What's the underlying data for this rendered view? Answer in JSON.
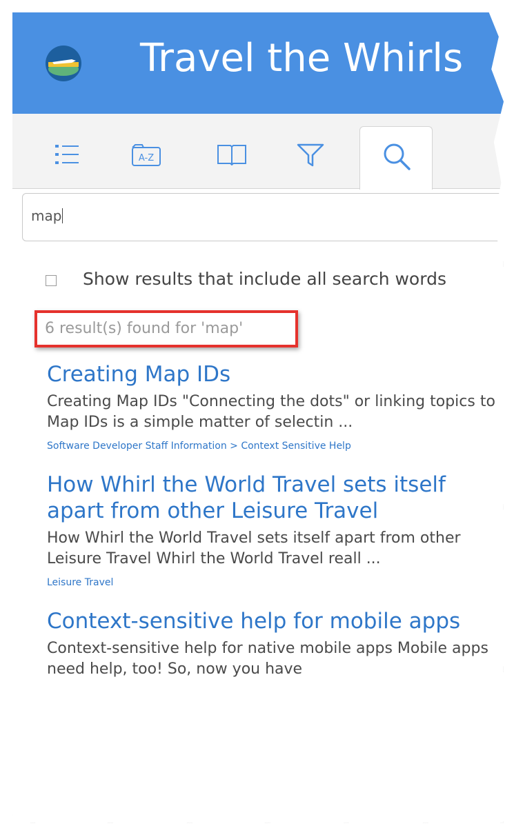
{
  "app": {
    "title": "Travel the Whirls",
    "logo_icon": "globe-airplane-logo"
  },
  "colors": {
    "header": "#4a90e2",
    "link": "#2e76c8",
    "highlight": "#e5322d"
  },
  "toolbar": {
    "tabs": [
      {
        "icon": "list-icon",
        "active": false
      },
      {
        "icon": "a-z-index-icon",
        "active": false
      },
      {
        "icon": "book-icon",
        "active": false
      },
      {
        "icon": "filter-icon",
        "active": false
      },
      {
        "icon": "search-icon",
        "active": true
      }
    ],
    "index_glyph": "A-Z"
  },
  "search": {
    "value": "map"
  },
  "options": {
    "all_words_label": "Show results that include all search words",
    "all_words_checked": false
  },
  "results_summary": "6 result(s) found for 'map'",
  "results": [
    {
      "title": "Creating Map IDs",
      "snippet": "Creating Map IDs \"Connecting the dots\" or linking topics to Map IDs is a simple matter of selectin ...",
      "breadcrumb": "Software Developer Staff Information > Context Sensitive Help"
    },
    {
      "title": "How Whirl the World Travel sets itself apart from other Leisure Travel",
      "snippet": "How Whirl the World Travel sets itself apart from other Leisure Travel Whirl the World Travel reall ...",
      "breadcrumb": "Leisure Travel"
    },
    {
      "title": "Context-sensitive help for mobile apps",
      "snippet": "Context-sensitive help for native mobile apps Mobile apps need help, too! So, now you have",
      "breadcrumb": ""
    }
  ]
}
